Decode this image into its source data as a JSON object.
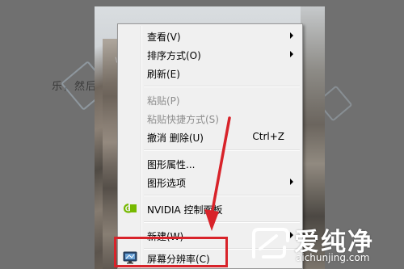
{
  "background": {
    "article_snippet": "乐，然后看到一些",
    "watermark_text": "纯净"
  },
  "menu": {
    "items": [
      {
        "label": "查看(V)",
        "submenu": true,
        "disabled": false
      },
      {
        "label": "排序方式(O)",
        "submenu": true,
        "disabled": false
      },
      {
        "label": "刷新(E)",
        "submenu": false,
        "disabled": false
      },
      {
        "label": "粘贴(P)",
        "submenu": false,
        "disabled": true
      },
      {
        "label": "粘贴快捷方式(S)",
        "submenu": false,
        "disabled": true
      },
      {
        "label": "撤消 删除(U)",
        "shortcut": "Ctrl+Z",
        "disabled": false
      },
      {
        "label": "图形属性...",
        "submenu": false,
        "disabled": false
      },
      {
        "label": "图形选项",
        "submenu": true,
        "disabled": false
      },
      {
        "label": "NVIDIA 控制面板",
        "icon": "nvidia-icon",
        "disabled": false
      },
      {
        "label": "新建(W)",
        "submenu": true,
        "disabled": false
      },
      {
        "label": "屏幕分辨率(C)",
        "icon": "monitor-icon",
        "disabled": false,
        "highlighted": true
      }
    ]
  },
  "annotation": {
    "color": "#d8232a",
    "target": "屏幕分辨率(C)"
  },
  "logo": {
    "title": "爱纯净",
    "url": "aichunjing.com",
    "icon": "aichunjing-logo-icon"
  }
}
